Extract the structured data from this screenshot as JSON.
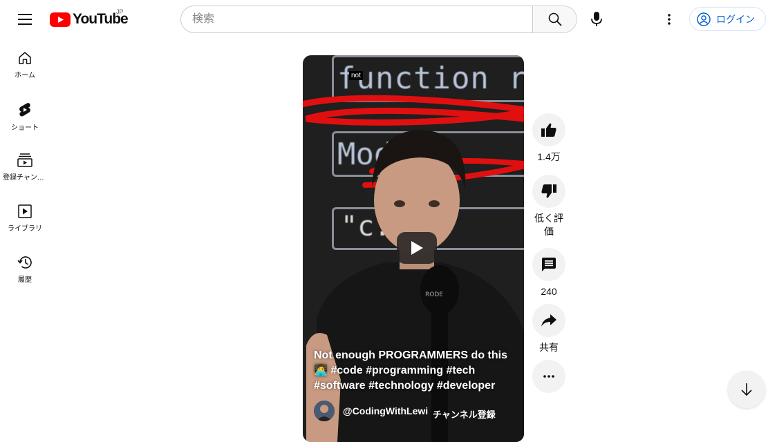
{
  "header": {
    "logo_text": "YouTube",
    "logo_country": "JP",
    "search_placeholder": "検索",
    "login_label": "ログイン",
    "brand_color": "#ff0000",
    "accent_color": "#065fd4"
  },
  "sidebar": {
    "items": [
      {
        "label": "ホーム",
        "icon": "home-icon"
      },
      {
        "label": "ショート",
        "icon": "shorts-icon"
      },
      {
        "label": "登録チャンネル",
        "icon": "subscriptions-icon"
      },
      {
        "label": "ライブラリ",
        "icon": "library-icon"
      },
      {
        "label": "履歴",
        "icon": "history-icon"
      }
    ]
  },
  "video": {
    "overlay_caption": "not",
    "code_lines": [
      "function r",
      "Mod",
      "\"c:  ot-"
    ],
    "title": "Not enough PROGRAMMERS do this 🧑‍💻",
    "hashtags": "#code #programming #tech #software #technology #developer",
    "channel": "@CodingWithLewi",
    "subscribe_label": "チャンネル登録"
  },
  "actions": {
    "like_count": "1.4万",
    "dislike_label": "低く評価",
    "comment_count": "240",
    "share_label": "共有"
  }
}
